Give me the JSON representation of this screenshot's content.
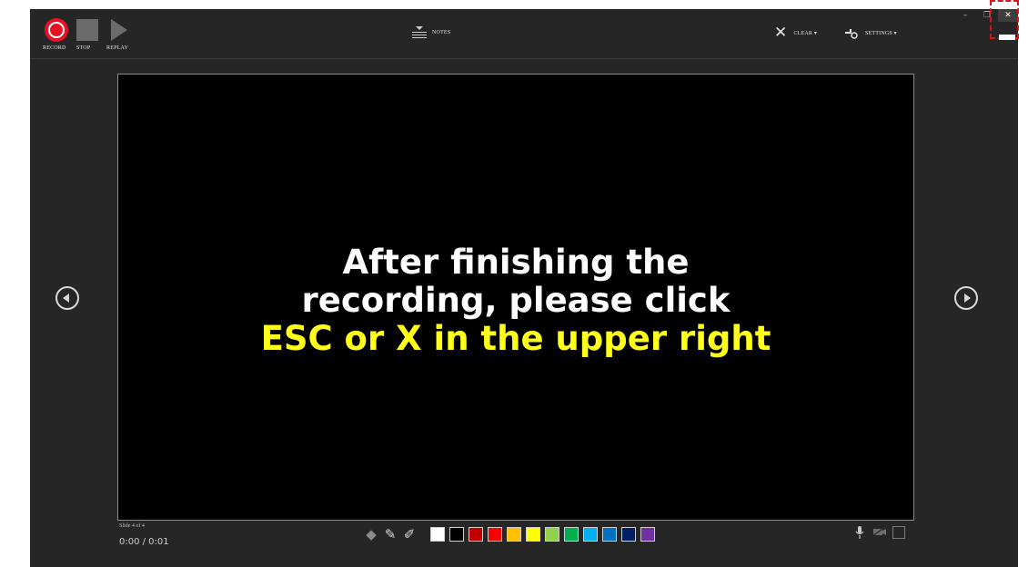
{
  "toolbar": {
    "record_label": "RECORD",
    "stop_label": "STOP",
    "replay_label": "REPLAY",
    "notes_label": "NOTES",
    "clear_label": "CLEAR ▾",
    "settings_label": "SETTINGS ▾"
  },
  "window_controls": {
    "minimize": "–",
    "restore": "❐",
    "close": "✕"
  },
  "slide": {
    "line1": "After finishing the",
    "line2": "recording, please click",
    "line3": "ESC or X in the upper right"
  },
  "footer": {
    "slide_counter": "Slide 4 of 4",
    "timer": "0:00 / 0:01"
  },
  "pen_colors": [
    "#ffffff",
    "#000000",
    "#c00000",
    "#ff0000",
    "#ffc000",
    "#ffff00",
    "#92d050",
    "#00b050",
    "#00b0f0",
    "#0070c0",
    "#002060",
    "#7030a0"
  ],
  "icons": {
    "record": "record-icon",
    "stop": "stop-icon",
    "replay": "replay-icon",
    "notes": "notes-icon",
    "clear": "clear-icon",
    "settings": "settings-icon",
    "eraser": "eraser-icon",
    "pen": "pen-icon",
    "highlighter": "highlighter-icon",
    "microphone": "microphone-icon",
    "camera": "camera-icon",
    "camera_preview": "camera-preview-icon"
  }
}
